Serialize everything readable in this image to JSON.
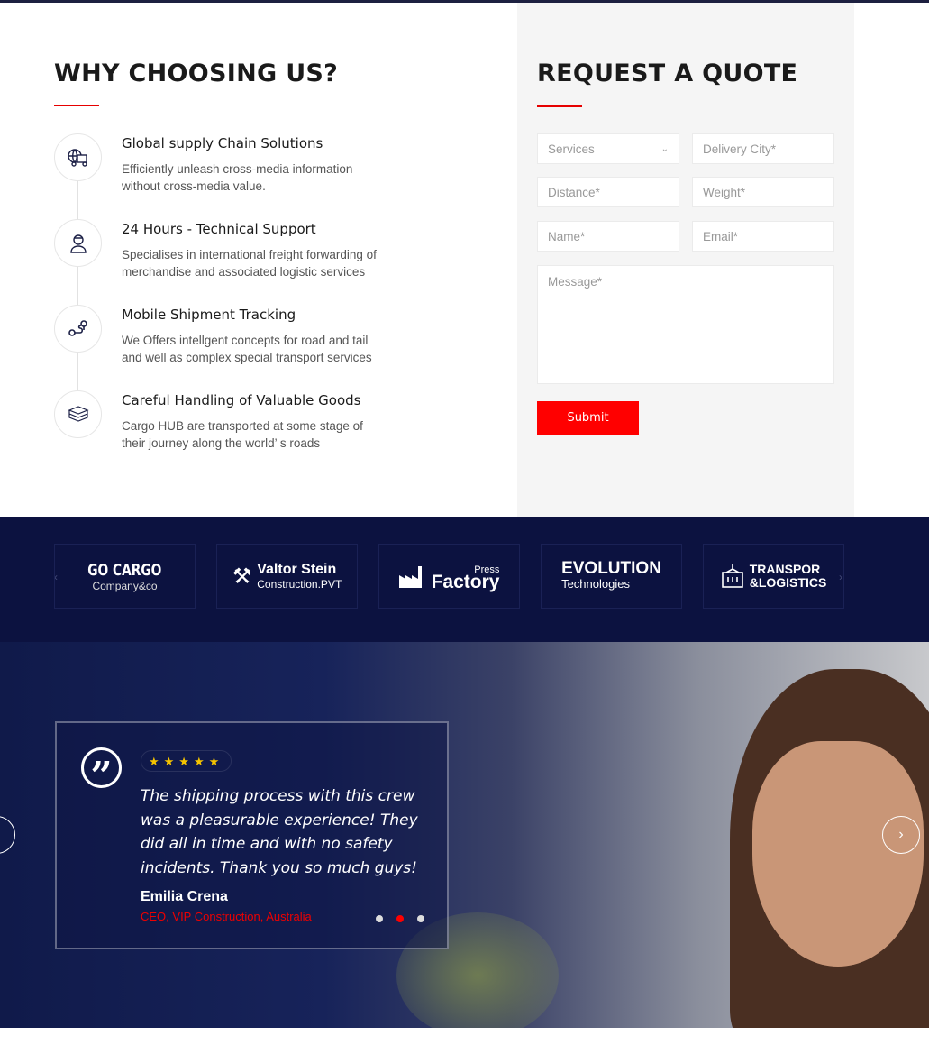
{
  "why": {
    "title": "WHY CHOOSING US?",
    "features": [
      {
        "icon": "globe-truck-icon",
        "title": "Global supply Chain Solutions",
        "desc": "Efficiently unleash cross-media information without cross-media value."
      },
      {
        "icon": "support-agent-icon",
        "title": "24 Hours - Technical Support",
        "desc": "Specialises in international freight forwarding of merchandise and associated logistic services"
      },
      {
        "icon": "route-tracking-icon",
        "title": "Mobile Shipment Tracking",
        "desc": "We Offers intellgent concepts for road and tail and well as complex special transport services"
      },
      {
        "icon": "package-box-icon",
        "title": "Careful Handling of Valuable Goods",
        "desc": "Cargo HUB are transported at some stage of their journey along the world’ s roads"
      }
    ]
  },
  "quote": {
    "title": "REQUEST A QUOTE",
    "services": "Services",
    "delivery_city": "Delivery City*",
    "distance": "Distance*",
    "weight": "Weight*",
    "name": "Name*",
    "email": "Email*",
    "message": "Message*",
    "submit": "Submit"
  },
  "logos": [
    {
      "line1": "GO CARGO",
      "line2": "Company&co"
    },
    {
      "line1": "Valtor Stein",
      "line2": "Construction.PVT"
    },
    {
      "line1": "Factory",
      "line2": "Press"
    },
    {
      "line1": "EVOLUTION",
      "line2": "Technologies"
    },
    {
      "line1": "TRANSPOR",
      "line2": "&LOGISTICS"
    }
  ],
  "testimonial": {
    "rating": 5,
    "stars": "★★★★★",
    "text": "The shipping process with this crew was a pleasurable experience! They did all in time and with no safety incidents. Thank you so much guys!",
    "name": "Emilia Crena",
    "role": "CEO, VIP Construction, Australia",
    "active_dot": 2,
    "accent": "#ff0000"
  }
}
